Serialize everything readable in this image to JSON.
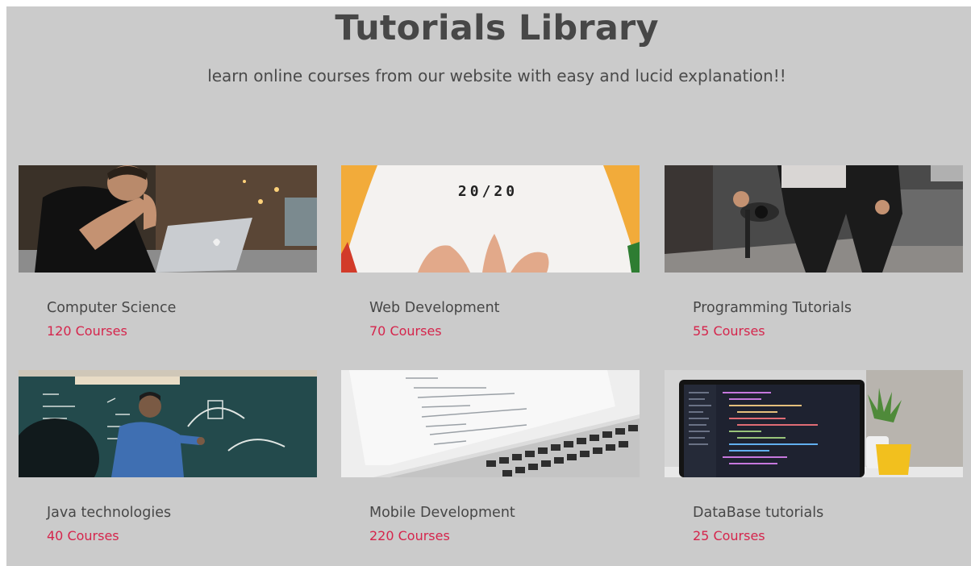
{
  "header": {
    "title": "Tutorials Library",
    "subtitle": "learn online courses from our website with easy and lucid explanation!!"
  },
  "colors": {
    "background": "#cbcbcb",
    "title_text": "#474747",
    "course_count": "#d5254c"
  },
  "cards": [
    {
      "title": "Computer Science",
      "count": "120 Courses",
      "image": "person-with-laptop-photo"
    },
    {
      "title": "Web Development",
      "count": "70 Courses",
      "image": "shirt-20-20-photo",
      "image_text": "20/20"
    },
    {
      "title": "Programming Tutorials",
      "count": "55 Courses",
      "image": "person-with-camera-photo"
    },
    {
      "title": "Java technologies",
      "count": "40 Courses",
      "image": "teacher-at-chalkboard-photo"
    },
    {
      "title": "Mobile Development",
      "count": "220 Courses",
      "image": "laptop-code-editor-photo"
    },
    {
      "title": "DataBase tutorials",
      "count": "25 Courses",
      "image": "laptop-dark-code-photo"
    }
  ]
}
